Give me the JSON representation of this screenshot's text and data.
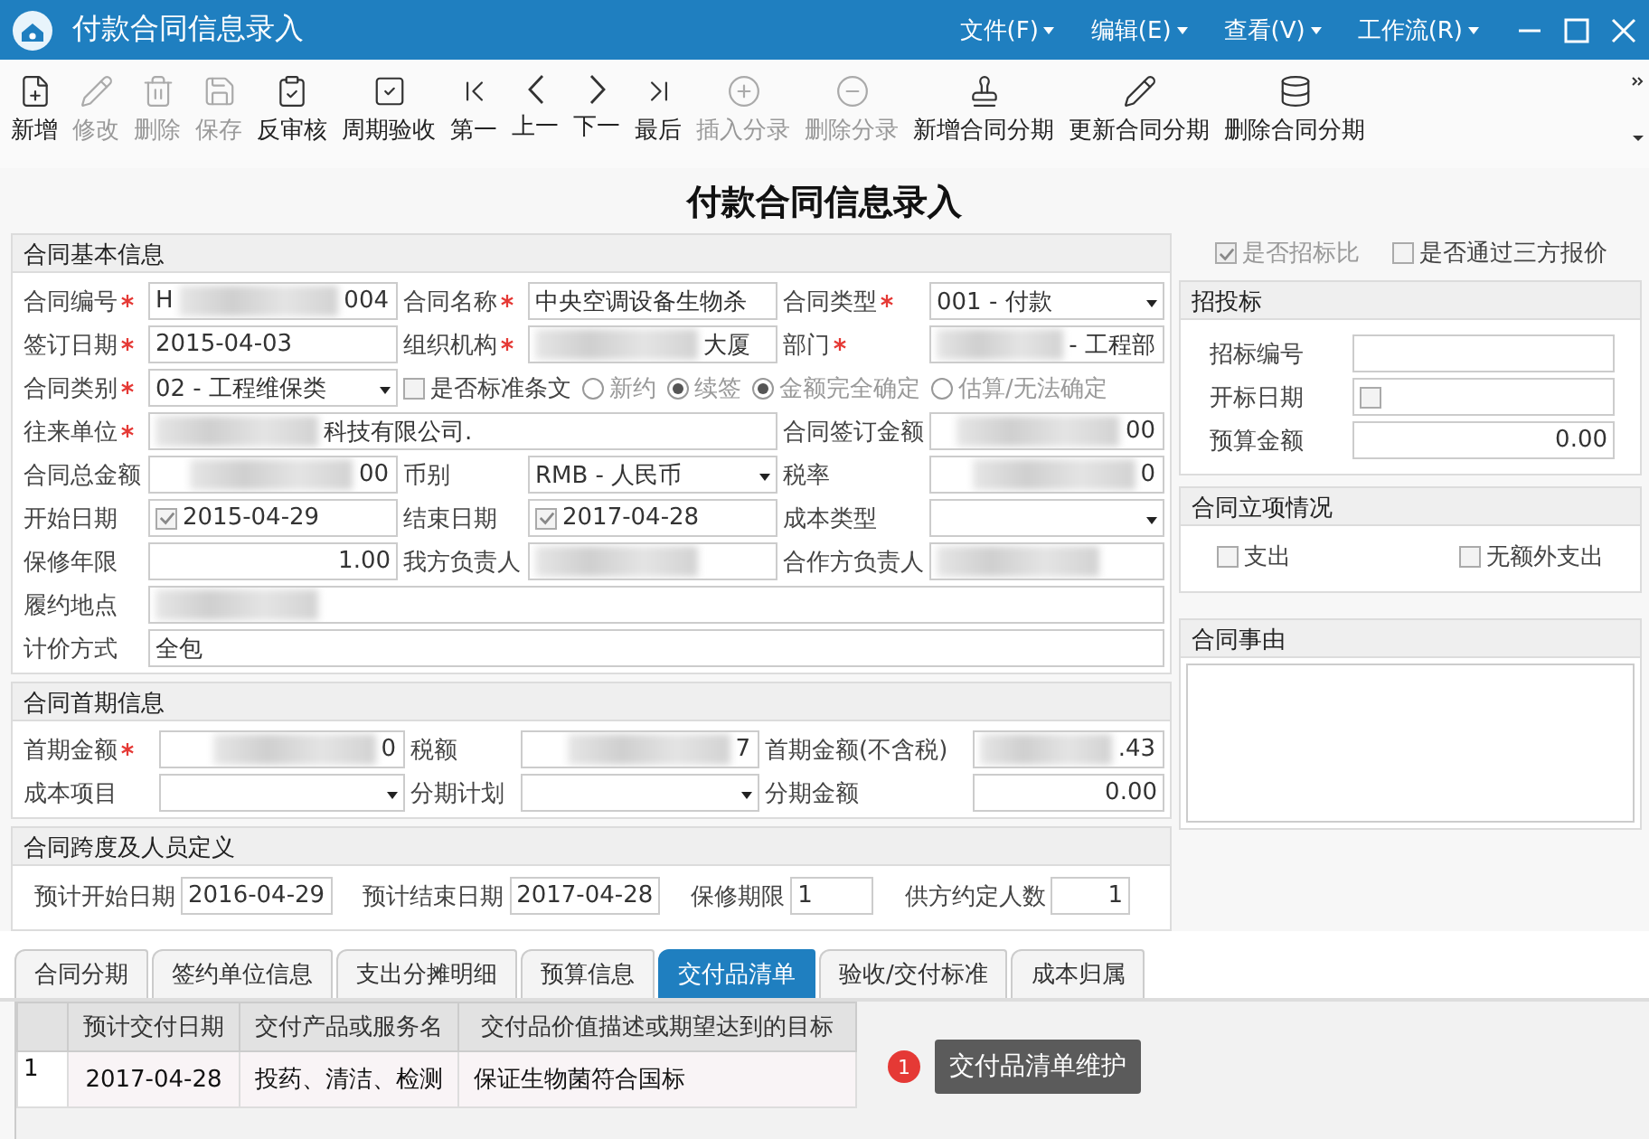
{
  "window": {
    "title": "付款合同信息录入"
  },
  "menu": [
    {
      "label": "文件(F)"
    },
    {
      "label": "编辑(E)"
    },
    {
      "label": "查看(V)"
    },
    {
      "label": "工作流(R)"
    }
  ],
  "toolbar": [
    {
      "label": "新增",
      "kind": "add",
      "disabled": false
    },
    {
      "label": "修改",
      "kind": "edit",
      "disabled": true
    },
    {
      "label": "删除",
      "kind": "delete",
      "disabled": true
    },
    {
      "label": "保存",
      "kind": "save",
      "disabled": true
    },
    {
      "label": "反审核",
      "kind": "clipboard",
      "disabled": false
    },
    {
      "label": "周期验收",
      "kind": "check",
      "disabled": false
    },
    {
      "label": "第一",
      "kind": "first",
      "disabled": false
    },
    {
      "label": "上一",
      "kind": "prev",
      "disabled": false
    },
    {
      "label": "下一",
      "kind": "next",
      "disabled": false
    },
    {
      "label": "最后",
      "kind": "last",
      "disabled": false
    },
    {
      "label": "插入分录",
      "kind": "plus",
      "disabled": true
    },
    {
      "label": "删除分录",
      "kind": "minus",
      "disabled": true
    },
    {
      "label": "新增合同分期",
      "kind": "stamp",
      "disabled": false
    },
    {
      "label": "更新合同分期",
      "kind": "edit",
      "disabled": false
    },
    {
      "label": "删除合同分期",
      "kind": "dbdelete",
      "disabled": false
    }
  ],
  "heading": "付款合同信息录入",
  "basic": {
    "title": "合同基本信息",
    "rows": [
      [
        {
          "kind": "text",
          "label": "合同编号",
          "required": true,
          "value": "H",
          "value_end": "004",
          "redacted": true
        },
        {
          "kind": "text",
          "label": "合同名称",
          "required": true,
          "value": "中央空调设备生物杀"
        },
        {
          "kind": "select",
          "label": "合同类型",
          "required": true,
          "value": "001 - 付款"
        }
      ],
      [
        {
          "kind": "text",
          "label": "签订日期",
          "required": true,
          "value": "2015-04-03"
        },
        {
          "kind": "text",
          "label": "组织机构",
          "required": true,
          "value_end": "大厦",
          "redacted": true
        },
        {
          "kind": "text",
          "label": "部门",
          "required": true,
          "value_end": "- 工程部",
          "redacted": true
        }
      ],
      [
        {
          "kind": "select",
          "label": "合同类别",
          "required": true,
          "value": "02 - 工程维保类"
        },
        {
          "kind": "options",
          "items": [
            {
              "kind": "checkbox",
              "label": "是否标准条文",
              "checked": false
            },
            {
              "kind": "radio",
              "label": "新约",
              "selected": false
            },
            {
              "kind": "radio",
              "label": "续签",
              "selected": true
            },
            {
              "kind": "radio",
              "label": "金额完全确定",
              "selected": true
            },
            {
              "kind": "radio",
              "label": "估算/无法确定",
              "selected": false
            }
          ]
        }
      ],
      [
        {
          "kind": "text",
          "label": "往来单位",
          "required": true,
          "value_end": "科技有限公司.",
          "redacted": true,
          "wide": true
        },
        {
          "kind": "number",
          "label": "合同签订金额",
          "value_end": "00",
          "redacted": true
        }
      ],
      [
        {
          "kind": "number",
          "label": "合同总金额",
          "value_end": "00",
          "redacted": true
        },
        {
          "kind": "select",
          "label": "币别",
          "value": "RMB - 人民币"
        },
        {
          "kind": "number",
          "label": "税率",
          "value_end": "0",
          "redacted": true
        }
      ],
      [
        {
          "kind": "date",
          "label": "开始日期",
          "checked": true,
          "value": "2015-04-29"
        },
        {
          "kind": "date",
          "label": "结束日期",
          "checked": true,
          "value": "2017-04-28"
        },
        {
          "kind": "select",
          "label": "成本类型"
        }
      ],
      [
        {
          "kind": "number",
          "label": "保修年限",
          "value": "1.00"
        },
        {
          "kind": "text",
          "label": "我方负责人",
          "redacted": true
        },
        {
          "kind": "text",
          "label": "合作方负责人",
          "redacted": true
        }
      ],
      [
        {
          "kind": "text",
          "label": "履约地点",
          "redacted": true,
          "full": true
        }
      ],
      [
        {
          "kind": "text",
          "label": "计价方式",
          "value": "全包",
          "full": true
        }
      ]
    ]
  },
  "first_period": {
    "title": "合同首期信息",
    "rows": [
      [
        {
          "kind": "number",
          "label": "首期金额",
          "required": true,
          "value_end": "0",
          "redacted": true
        },
        {
          "kind": "number",
          "label": "税额",
          "value_end": "7",
          "redacted": true
        },
        {
          "kind": "number",
          "label": "首期金额(不含税)",
          "value_end": ".43",
          "redacted": true
        }
      ],
      [
        {
          "kind": "select",
          "label": "成本项目"
        },
        {
          "kind": "select",
          "label": "分期计划"
        },
        {
          "kind": "number",
          "label": "分期金额",
          "value": "0.00"
        }
      ]
    ]
  },
  "span": {
    "title": "合同跨度及人员定义",
    "fields": [
      {
        "kind": "text",
        "label": "预计开始日期",
        "value": "2016-04-29"
      },
      {
        "kind": "text",
        "label": "预计结束日期",
        "value": "2017-04-28"
      },
      {
        "kind": "text",
        "label": "保修期限",
        "value": "1"
      },
      {
        "kind": "number",
        "label": "供方约定人数",
        "value": "1"
      }
    ]
  },
  "right": {
    "checks": [
      {
        "label": "是否招标比",
        "checked": true,
        "disabled": true
      },
      {
        "label": "是否通过三方报价",
        "checked": false,
        "disabled": false
      }
    ],
    "bidding": {
      "title": "招投标",
      "fields": [
        {
          "kind": "text",
          "label": "招标编号"
        },
        {
          "kind": "date",
          "label": "开标日期",
          "checked": false
        },
        {
          "kind": "number",
          "label": "预算金额",
          "value": "0.00"
        }
      ]
    },
    "approval": {
      "title": "合同立项情况",
      "checks": [
        {
          "label": "支出",
          "checked": false
        },
        {
          "label": "无额外支出",
          "checked": false
        }
      ]
    },
    "reason": {
      "title": "合同事由"
    }
  },
  "tabs": [
    {
      "label": "合同分期",
      "selected": false
    },
    {
      "label": "签约单位信息",
      "selected": false
    },
    {
      "label": "支出分摊明细",
      "selected": false
    },
    {
      "label": "预算信息",
      "selected": false
    },
    {
      "label": "交付品清单",
      "selected": true
    },
    {
      "label": "验收/交付标准",
      "selected": false
    },
    {
      "label": "成本归属",
      "selected": false
    }
  ],
  "table": {
    "columns": [
      "预计交付日期",
      "交付产品或服务名",
      "交付品价值描述或期望达到的目标"
    ],
    "rows": [
      {
        "index": "1",
        "cells": [
          "2017-04-28",
          "投药、清洁、检测",
          "保证生物菌符合国标"
        ]
      }
    ]
  },
  "tooltip": {
    "badge": "1",
    "text": "交付品清单维护"
  }
}
